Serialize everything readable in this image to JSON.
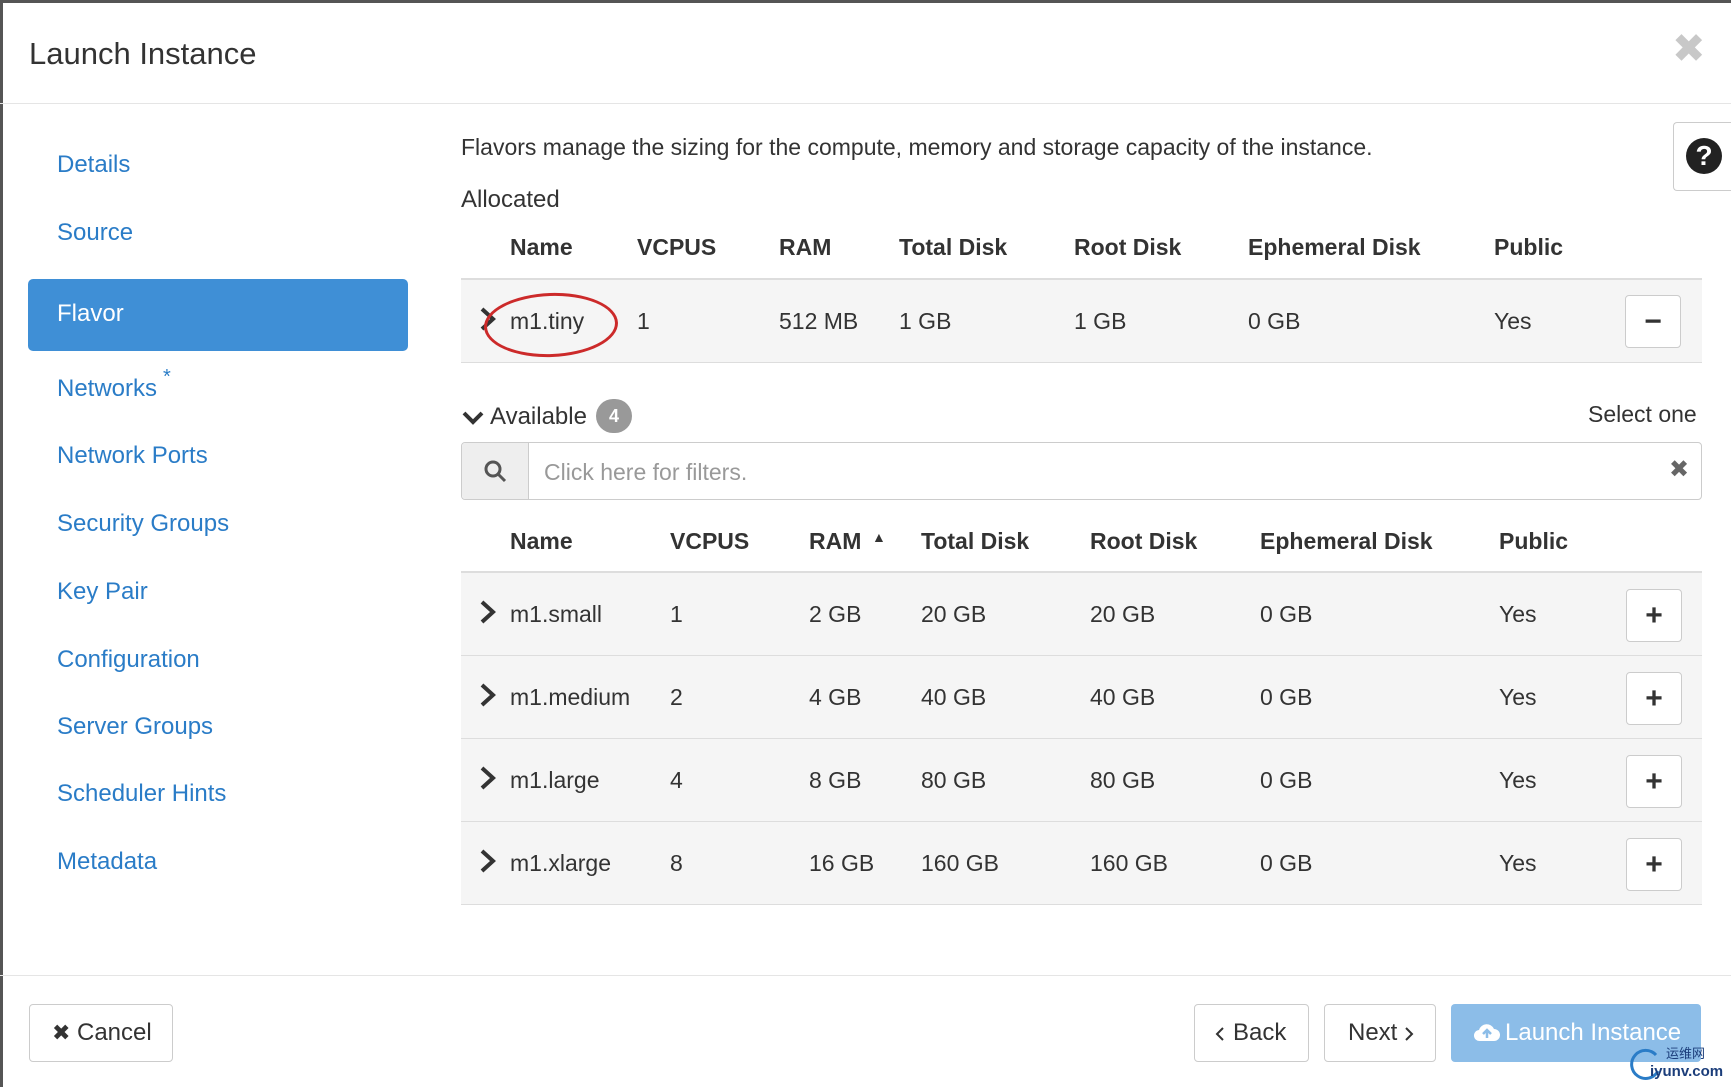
{
  "modal": {
    "title": "Launch Instance",
    "close_glyph": "✖"
  },
  "sidebar": {
    "items": [
      {
        "label": "Details"
      },
      {
        "label": "Source"
      },
      {
        "label": "Flavor"
      },
      {
        "label": "Networks",
        "required_mark": "*"
      },
      {
        "label": "Network Ports"
      },
      {
        "label": "Security Groups"
      },
      {
        "label": "Key Pair"
      },
      {
        "label": "Configuration"
      },
      {
        "label": "Server Groups"
      },
      {
        "label": "Scheduler Hints"
      },
      {
        "label": "Metadata"
      }
    ]
  },
  "help": {
    "glyph": "?"
  },
  "description": "Flavors manage the sizing for the compute, memory and storage capacity of the instance.",
  "allocated": {
    "title": "Allocated",
    "columns": [
      "Name",
      "VCPUS",
      "RAM",
      "Total Disk",
      "Root Disk",
      "Ephemeral Disk",
      "Public"
    ],
    "rows": [
      {
        "name": "m1.tiny",
        "vcpus": "1",
        "ram": "512 MB",
        "total_disk": "1 GB",
        "root_disk": "1 GB",
        "ephemeral_disk": "0 GB",
        "public": "Yes",
        "action": "−"
      }
    ]
  },
  "available": {
    "title": "Available",
    "count": "4",
    "select_hint": "Select one",
    "filter_placeholder": "Click here for filters.",
    "filter_clear": "✖",
    "sort_indicator": "▲",
    "columns": [
      "Name",
      "VCPUS",
      "RAM",
      "Total Disk",
      "Root Disk",
      "Ephemeral Disk",
      "Public"
    ],
    "rows": [
      {
        "name": "m1.small",
        "vcpus": "1",
        "ram": "2 GB",
        "total_disk": "20 GB",
        "root_disk": "20 GB",
        "ephemeral_disk": "0 GB",
        "public": "Yes",
        "action": "+"
      },
      {
        "name": "m1.medium",
        "vcpus": "2",
        "ram": "4 GB",
        "total_disk": "40 GB",
        "root_disk": "40 GB",
        "ephemeral_disk": "0 GB",
        "public": "Yes",
        "action": "+"
      },
      {
        "name": "m1.large",
        "vcpus": "4",
        "ram": "8 GB",
        "total_disk": "80 GB",
        "root_disk": "80 GB",
        "ephemeral_disk": "0 GB",
        "public": "Yes",
        "action": "+"
      },
      {
        "name": "m1.xlarge",
        "vcpus": "8",
        "ram": "16 GB",
        "total_disk": "160 GB",
        "root_disk": "160 GB",
        "ephemeral_disk": "0 GB",
        "public": "Yes",
        "action": "+"
      }
    ]
  },
  "footer": {
    "cancel_icon": "✖",
    "cancel_label": "Cancel",
    "back_label": "Back",
    "next_label": "Next",
    "launch_label": "Launch Instance"
  },
  "watermark": {
    "cn": "运维网",
    "en": "iyunv.com"
  },
  "colors": {
    "accent": "#3f8fd6",
    "link": "#2a7cc7",
    "primary_disabled": "#8cbde8",
    "highlight_circle": "#cc2a2a"
  }
}
